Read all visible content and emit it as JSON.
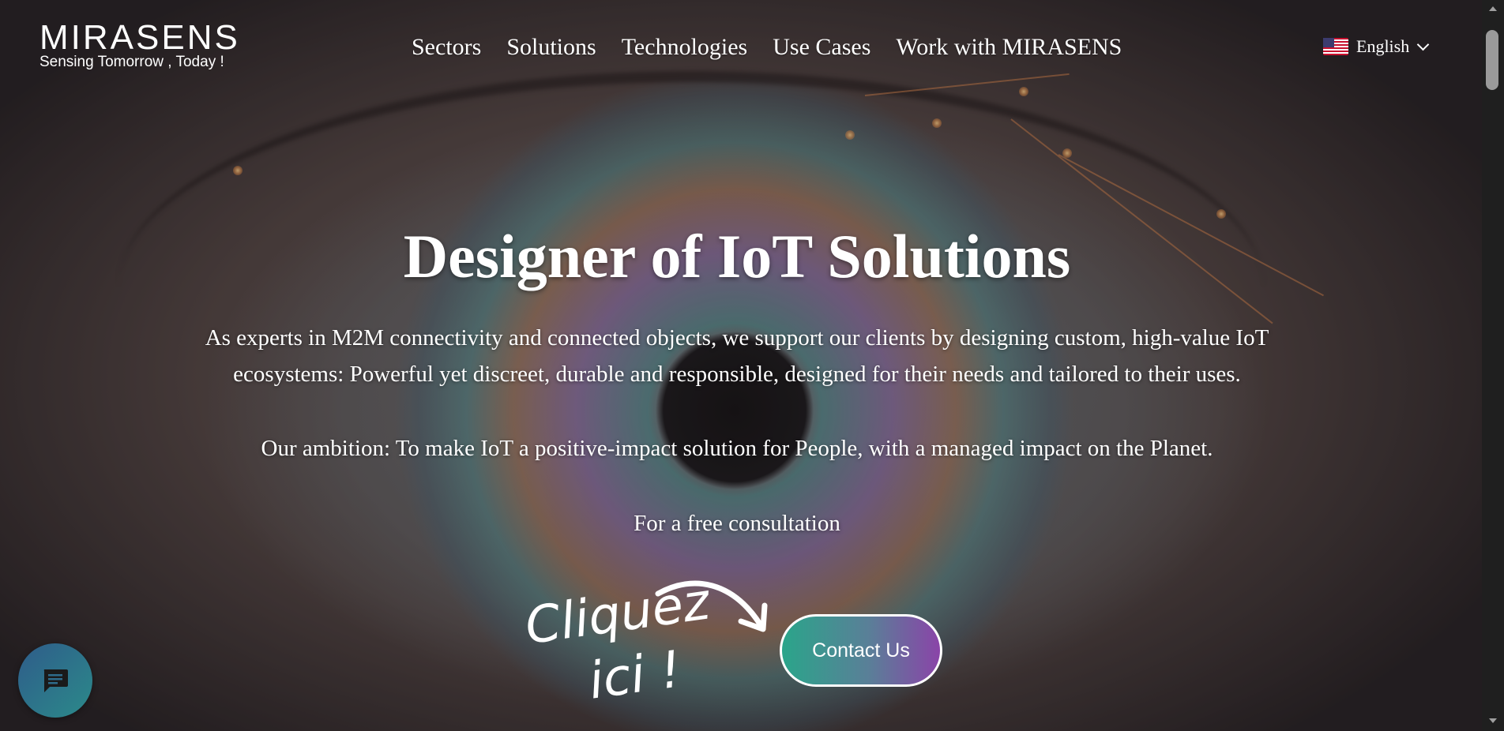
{
  "header": {
    "logo_text": "MIRASENS",
    "logo_tagline": "Sensing Tomorrow , Today !",
    "nav": [
      {
        "label": "Sectors"
      },
      {
        "label": "Solutions"
      },
      {
        "label": "Technologies"
      },
      {
        "label": "Use Cases"
      },
      {
        "label": "Work with MIRASENS"
      }
    ],
    "language": {
      "label": "English",
      "flag_icon": "us-flag-icon"
    }
  },
  "hero": {
    "title": "Designer of IoT Solutions",
    "description": "As experts in M2M connectivity and connected objects, we support our clients by designing custom, high-value IoT ecosystems: Powerful yet discreet, durable and responsible, designed for their needs and tailored to their uses.",
    "ambition": "Our ambition: To make IoT a positive-impact solution for People, with a managed impact on the Planet.",
    "consultation_text": "For a free consultation",
    "handwriting_line1": "Cliquez",
    "handwriting_line2": "ici !",
    "cta_label": "Contact Us"
  },
  "chat": {
    "icon": "chat-icon"
  },
  "colors": {
    "cta_gradient_start": "#2aa58a",
    "cta_gradient_end": "#8a44a8",
    "chat_bg": "#2e5c8a",
    "text": "#ffffff"
  }
}
